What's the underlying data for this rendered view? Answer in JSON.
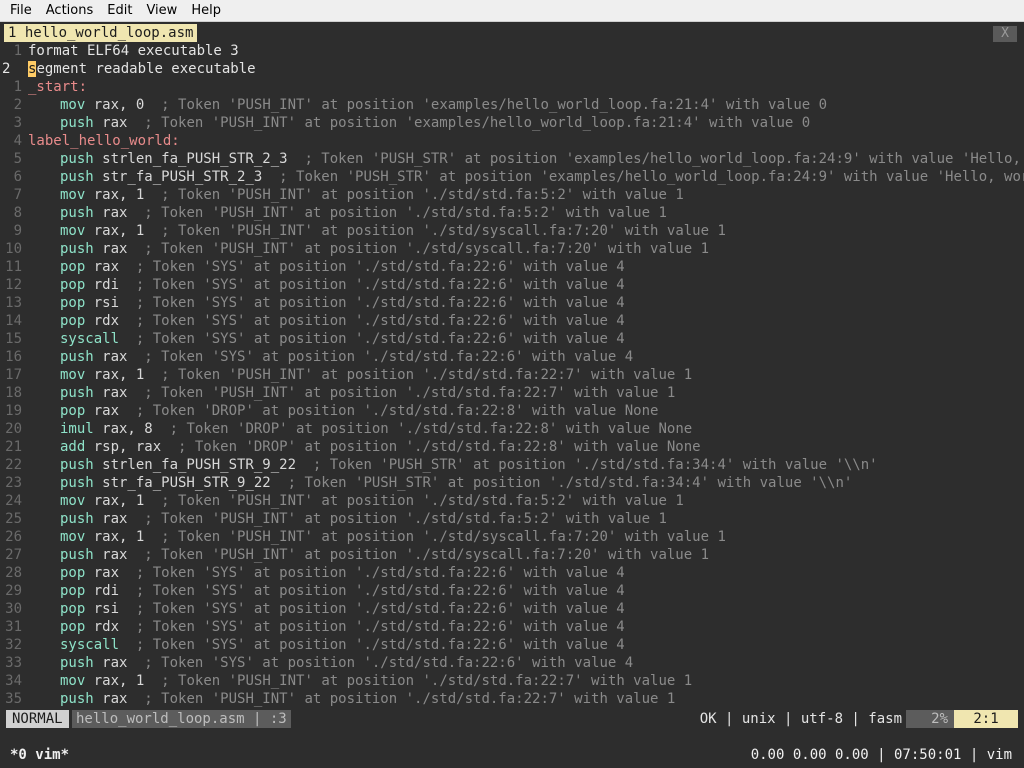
{
  "menubar": {
    "items": [
      "File",
      "Actions",
      "Edit",
      "View",
      "Help"
    ]
  },
  "tabline": {
    "active_tab": "1 hello_world_loop.asm",
    "close_label": "X"
  },
  "lines": [
    {
      "num": "1",
      "text": "format ELF64 executable 3"
    },
    {
      "num": "2",
      "cur": true,
      "cursor": "s",
      "text": "egment readable executable"
    },
    {
      "num": "1",
      "label": "_start:"
    },
    {
      "num": "2",
      "ind": 1,
      "kw": "mov",
      "arg": " rax, 0",
      "cm": "  ; Token 'PUSH_INT' at position 'examples/hello_world_loop.fa:21:4' with value 0"
    },
    {
      "num": "3",
      "ind": 1,
      "kw": "push",
      "arg": " rax",
      "cm": "  ; Token 'PUSH_INT' at position 'examples/hello_world_loop.fa:21:4' with value 0"
    },
    {
      "num": "4",
      "label": "label_hello_world:"
    },
    {
      "num": "5",
      "ind": 1,
      "kw": "push",
      "arg": " strlen_fa_PUSH_STR_2_3",
      "cm": "  ; Token 'PUSH_STR' at position 'examples/hello_world_loop.fa:24:9' with value 'Hello, wor"
    },
    {
      "num": "6",
      "ind": 1,
      "kw": "push",
      "arg": " str_fa_PUSH_STR_2_3",
      "cm": "  ; Token 'PUSH_STR' at position 'examples/hello_world_loop.fa:24:9' with value 'Hello, world!'"
    },
    {
      "num": "7",
      "ind": 1,
      "kw": "mov",
      "arg": " rax, 1",
      "cm": "  ; Token 'PUSH_INT' at position './std/std.fa:5:2' with value 1"
    },
    {
      "num": "8",
      "ind": 1,
      "kw": "push",
      "arg": " rax",
      "cm": "  ; Token 'PUSH_INT' at position './std/std.fa:5:2' with value 1"
    },
    {
      "num": "9",
      "ind": 1,
      "kw": "mov",
      "arg": " rax, 1",
      "cm": "  ; Token 'PUSH_INT' at position './std/syscall.fa:7:20' with value 1"
    },
    {
      "num": "10",
      "ind": 1,
      "kw": "push",
      "arg": " rax",
      "cm": "  ; Token 'PUSH_INT' at position './std/syscall.fa:7:20' with value 1"
    },
    {
      "num": "11",
      "ind": 1,
      "kw": "pop",
      "arg": " rax",
      "cm": "  ; Token 'SYS' at position './std/std.fa:22:6' with value 4"
    },
    {
      "num": "12",
      "ind": 1,
      "kw": "pop",
      "arg": " rdi",
      "cm": "  ; Token 'SYS' at position './std/std.fa:22:6' with value 4"
    },
    {
      "num": "13",
      "ind": 1,
      "kw": "pop",
      "arg": " rsi",
      "cm": "  ; Token 'SYS' at position './std/std.fa:22:6' with value 4"
    },
    {
      "num": "14",
      "ind": 1,
      "kw": "pop",
      "arg": " rdx",
      "cm": "  ; Token 'SYS' at position './std/std.fa:22:6' with value 4"
    },
    {
      "num": "15",
      "ind": 1,
      "kw": "syscall",
      "arg": "",
      "cm": "  ; Token 'SYS' at position './std/std.fa:22:6' with value 4"
    },
    {
      "num": "16",
      "ind": 1,
      "kw": "push",
      "arg": " rax",
      "cm": "  ; Token 'SYS' at position './std/std.fa:22:6' with value 4"
    },
    {
      "num": "17",
      "ind": 1,
      "kw": "mov",
      "arg": " rax, 1",
      "cm": "  ; Token 'PUSH_INT' at position './std/std.fa:22:7' with value 1"
    },
    {
      "num": "18",
      "ind": 1,
      "kw": "push",
      "arg": " rax",
      "cm": "  ; Token 'PUSH_INT' at position './std/std.fa:22:7' with value 1"
    },
    {
      "num": "19",
      "ind": 1,
      "kw": "pop",
      "arg": " rax",
      "cm": "  ; Token 'DROP' at position './std/std.fa:22:8' with value None"
    },
    {
      "num": "20",
      "ind": 1,
      "kw": "imul",
      "arg": " rax, 8",
      "cm": "  ; Token 'DROP' at position './std/std.fa:22:8' with value None"
    },
    {
      "num": "21",
      "ind": 1,
      "kw": "add",
      "arg": " rsp, rax",
      "cm": "  ; Token 'DROP' at position './std/std.fa:22:8' with value None"
    },
    {
      "num": "22",
      "ind": 1,
      "kw": "push",
      "arg": " strlen_fa_PUSH_STR_9_22",
      "cm": "  ; Token 'PUSH_STR' at position './std/std.fa:34:4' with value '\\\\n'"
    },
    {
      "num": "23",
      "ind": 1,
      "kw": "push",
      "arg": " str_fa_PUSH_STR_9_22",
      "cm": "  ; Token 'PUSH_STR' at position './std/std.fa:34:4' with value '\\\\n'"
    },
    {
      "num": "24",
      "ind": 1,
      "kw": "mov",
      "arg": " rax, 1",
      "cm": "  ; Token 'PUSH_INT' at position './std/std.fa:5:2' with value 1"
    },
    {
      "num": "25",
      "ind": 1,
      "kw": "push",
      "arg": " rax",
      "cm": "  ; Token 'PUSH_INT' at position './std/std.fa:5:2' with value 1"
    },
    {
      "num": "26",
      "ind": 1,
      "kw": "mov",
      "arg": " rax, 1",
      "cm": "  ; Token 'PUSH_INT' at position './std/syscall.fa:7:20' with value 1"
    },
    {
      "num": "27",
      "ind": 1,
      "kw": "push",
      "arg": " rax",
      "cm": "  ; Token 'PUSH_INT' at position './std/syscall.fa:7:20' with value 1"
    },
    {
      "num": "28",
      "ind": 1,
      "kw": "pop",
      "arg": " rax",
      "cm": "  ; Token 'SYS' at position './std/std.fa:22:6' with value 4"
    },
    {
      "num": "29",
      "ind": 1,
      "kw": "pop",
      "arg": " rdi",
      "cm": "  ; Token 'SYS' at position './std/std.fa:22:6' with value 4"
    },
    {
      "num": "30",
      "ind": 1,
      "kw": "pop",
      "arg": " rsi",
      "cm": "  ; Token 'SYS' at position './std/std.fa:22:6' with value 4"
    },
    {
      "num": "31",
      "ind": 1,
      "kw": "pop",
      "arg": " rdx",
      "cm": "  ; Token 'SYS' at position './std/std.fa:22:6' with value 4"
    },
    {
      "num": "32",
      "ind": 1,
      "kw": "syscall",
      "arg": "",
      "cm": "  ; Token 'SYS' at position './std/std.fa:22:6' with value 4"
    },
    {
      "num": "33",
      "ind": 1,
      "kw": "push",
      "arg": " rax",
      "cm": "  ; Token 'SYS' at position './std/std.fa:22:6' with value 4"
    },
    {
      "num": "34",
      "ind": 1,
      "kw": "mov",
      "arg": " rax, 1",
      "cm": "  ; Token 'PUSH_INT' at position './std/std.fa:22:7' with value 1"
    },
    {
      "num": "35",
      "ind": 1,
      "kw": "push",
      "arg": " rax",
      "cm": "  ; Token 'PUSH_INT' at position './std/std.fa:22:7' with value 1"
    }
  ],
  "statusline": {
    "mode": "NORMAL",
    "file": "hello_world_loop.asm | :3",
    "right": "OK | unix | utf-8 | fasm",
    "percent": "2%",
    "position": "2:1"
  },
  "tmux": {
    "window": "*0 vim*",
    "right": "0.00 0.00 0.00 | 07:50:01 | vim"
  },
  "colors": {
    "background": "#2d2d2d",
    "keyword": "#8ee2c8",
    "comment": "#8a8a8a",
    "label": "#e88b8b",
    "tab_active": "#f0e6b0"
  }
}
